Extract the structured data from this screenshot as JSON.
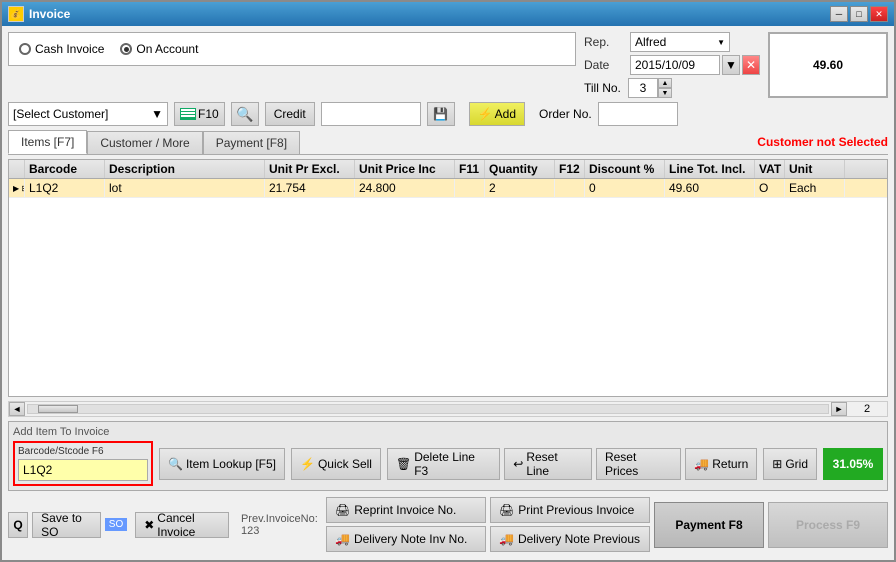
{
  "window": {
    "title": "Invoice"
  },
  "invoice_type": {
    "cash_label": "Cash Invoice",
    "on_account_label": "On Account",
    "active": "on_account"
  },
  "rep": {
    "label": "Rep.",
    "value": "Alfred"
  },
  "date": {
    "label": "Date",
    "value": "2015/10/09"
  },
  "till": {
    "label": "Till No.",
    "value": "3"
  },
  "total": "49.60",
  "customer": {
    "placeholder": "[Select Customer]",
    "not_selected_msg": "Customer not Selected"
  },
  "credit": {
    "label": "Credit"
  },
  "order_no": {
    "label": "Order No."
  },
  "tabs": {
    "items": "Items [F7]",
    "customer_more": "Customer / More",
    "payment": "Payment [F8]"
  },
  "table": {
    "headers": [
      "",
      "Barcode",
      "Description",
      "Unit Pr Excl.",
      "Unit Price Inc",
      "F11",
      "Quantity",
      "F12",
      "Discount %",
      "Line Tot. Incl.",
      "VAT",
      "Unit"
    ],
    "rows": [
      {
        "arrow": "▶",
        "expand": "⊞",
        "barcode": "L1Q2",
        "description": "lot",
        "unit_pr_excl": "21.754",
        "unit_price_inc": "24.800",
        "f11": "",
        "quantity": "2",
        "f12": "",
        "discount": "0",
        "line_tot": "49.60",
        "vat": "O",
        "unit": "Each"
      }
    ],
    "page_num": "2"
  },
  "add_item": {
    "label": "Add Item To Invoice",
    "barcode_label": "Barcode/Stcode F6",
    "barcode_value": "L1Q2"
  },
  "buttons": {
    "item_lookup": "Item Lookup [F5]",
    "quick_sell": "Quick Sell",
    "delete_line": "Delete Line F3",
    "reset_line": "Reset Line",
    "reset_prices": "Reset Prices",
    "return": "Return",
    "grid": "Grid",
    "percent": "31.05%",
    "q": "Q",
    "save_to_so": "Save to SO",
    "so": "SO",
    "cancel_invoice": "Cancel Invoice",
    "prev_invoice_no": "Prev.InvoiceNo: 123",
    "reprint_invoice": "Reprint Invoice No.",
    "print_prev_invoice": "Print Previous Invoice",
    "delivery_note_inv": "Delivery Note Inv No.",
    "delivery_note_prev": "Delivery Note Previous",
    "payment_f8": "Payment F8",
    "process_f9": "Process F9"
  },
  "icons": {
    "search": "🔍",
    "lightning": "⚡",
    "printer": "🖨",
    "truck": "🚚",
    "delete": "🗑",
    "reset": "↩",
    "return_icon": "↩",
    "grid_icon": "⊞",
    "save": "💾",
    "cancel": "✖",
    "add": "⚡",
    "chart": "📊"
  }
}
